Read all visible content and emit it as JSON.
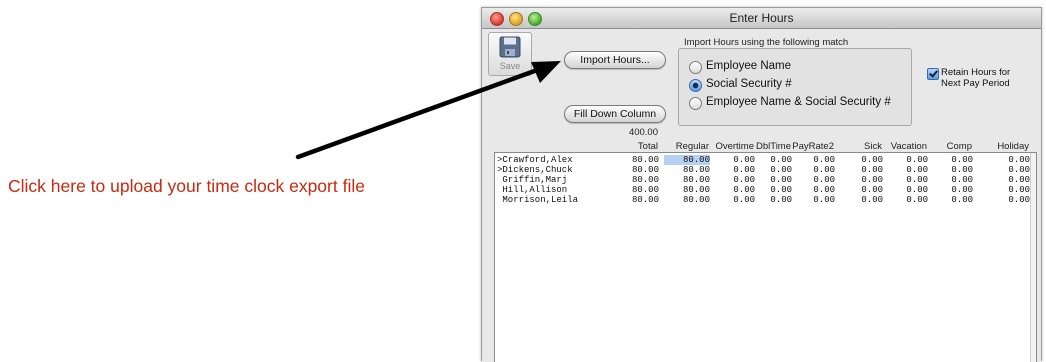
{
  "annotation": {
    "text": "Click here to upload your time clock export file",
    "color": "#c8290f"
  },
  "window": {
    "title": "Enter Hours"
  },
  "toolbar": {
    "save_label": "Save"
  },
  "buttons": {
    "import_label": "Import Hours...",
    "filldown_label": "Fill Down Column"
  },
  "match_group": {
    "label": "Import Hours using the following match",
    "options": [
      {
        "label": "Employee Name",
        "selected": false
      },
      {
        "label": "Social Security #",
        "selected": true
      },
      {
        "label": "Employee Name & Social Security #",
        "selected": false
      }
    ]
  },
  "retain": {
    "checked": true,
    "line1": "Retain Hours for",
    "line2": "Next Pay Period"
  },
  "grand_total": "400.00",
  "columns": [
    "Total",
    "Regular",
    "Overtime",
    "DblTime",
    "PayRate2",
    "Sick",
    "Vacation",
    "Comp",
    "Holiday"
  ],
  "rows": [
    {
      "name": ">Crawford,Alex",
      "values": [
        "80.00",
        "80.00",
        "0.00",
        "0.00",
        "0.00",
        "0.00",
        "0.00",
        "0.00",
        "0.00"
      ]
    },
    {
      "name": ">Dickens,Chuck",
      "values": [
        "80.00",
        "80.00",
        "0.00",
        "0.00",
        "0.00",
        "0.00",
        "0.00",
        "0.00",
        "0.00"
      ]
    },
    {
      "name": " Griffin,Marj",
      "values": [
        "80.00",
        "80.00",
        "0.00",
        "0.00",
        "0.00",
        "0.00",
        "0.00",
        "0.00",
        "0.00"
      ]
    },
    {
      "name": " Hill,Allison",
      "values": [
        "80.00",
        "80.00",
        "0.00",
        "0.00",
        "0.00",
        "0.00",
        "0.00",
        "0.00",
        "0.00"
      ]
    },
    {
      "name": " Morrison,Leila",
      "values": [
        "80.00",
        "80.00",
        "0.00",
        "0.00",
        "0.00",
        "0.00",
        "0.00",
        "0.00",
        "0.00"
      ]
    }
  ],
  "icons": {
    "save": "floppy-disk-icon",
    "arrow": "arrow-pointer-icon"
  },
  "colors": {
    "selection": "#b7d1f2",
    "annotation": "#c8290f"
  }
}
